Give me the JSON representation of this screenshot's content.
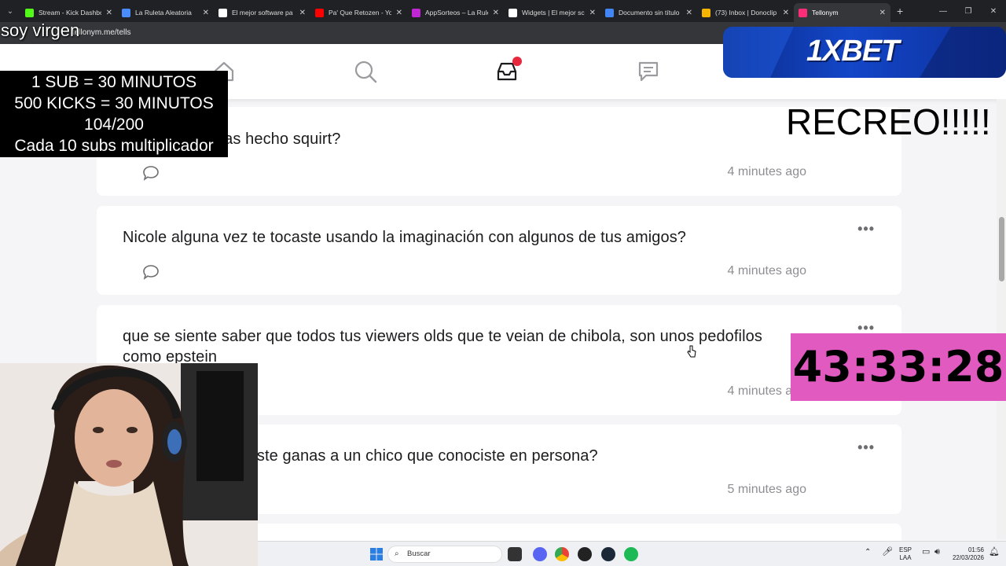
{
  "browser": {
    "tabs": [
      {
        "title": "Stream - Kick Dashbo",
        "fav": "#53fc18"
      },
      {
        "title": "La Ruleta Aleatoria",
        "fav": "#4a8cff"
      },
      {
        "title": "El mejor software pa",
        "fav": "#ffffff"
      },
      {
        "title": "Pa' Que Retozen - Yo",
        "fav": "#ff0000"
      },
      {
        "title": "AppSorteos – La Rule",
        "fav": "#c026d3"
      },
      {
        "title": "Widgets | El mejor sc",
        "fav": "#ffffff"
      },
      {
        "title": "Documento sin título",
        "fav": "#4285f4"
      },
      {
        "title": "(73) Inbox | Donoclip",
        "fav": "#f4b400"
      },
      {
        "title": "Tellonym",
        "fav": "#ff2d78"
      }
    ],
    "url": "tellonym.me/tells"
  },
  "tells": [
    {
      "question": "¿Alguna vez has hecho squirt?",
      "time": "4 minutes ago"
    },
    {
      "question": "Nicole alguna vez te tocaste usando la imaginación con algunos de tus amigos?",
      "time": "4 minutes ago"
    },
    {
      "question": "que se siente saber que todos tus viewers olds que te veian de chibola, son unos pedofilos como epstein",
      "time": "4 minutes ago"
    },
    {
      "question": "¿Alguna vez le tuviste ganas a un chico que conociste en persona?",
      "time": "5 minutes ago"
    }
  ],
  "overlays": {
    "top_text": "soy virgen",
    "subathon": [
      "1 SUB     = 30 MINUTOS",
      "500 KICKS = 30 MINUTOS",
      "104/200",
      "Cada 10 subs multiplicador"
    ],
    "sponsor": "1XBET",
    "recreo": "RECREO!!!!!",
    "timer": "43:33:28"
  },
  "taskbar": {
    "search_placeholder": "Buscar",
    "lang": "ESP",
    "lang2": "LAA",
    "time": "01:56",
    "date": "22/03/2026"
  }
}
